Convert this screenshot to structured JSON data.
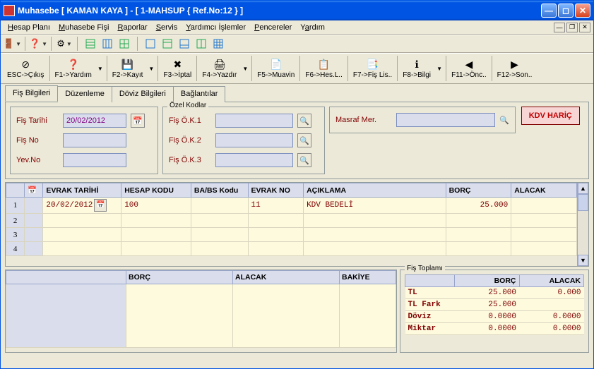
{
  "window": {
    "title": "Muhasebe [ KAMAN KAYA ]  - [ 1-MAHSUP { Ref.No:12 } ]"
  },
  "menu": {
    "hesap_plani": "Hesap Planı",
    "muhasebe_fisi": "Muhasebe Fişi",
    "raporlar": "Raporlar",
    "servis": "Servis",
    "yardimci": "Yardımcı İşlemler",
    "pencereler": "Pencereler",
    "yardim": "Yardım"
  },
  "toolbar": {
    "esc": "ESC->Çıkış",
    "f1": "F1->Yardım",
    "f2": "F2->Kayıt",
    "f3": "F3->İptal",
    "f4": "F4->Yazdır",
    "f5": "F5->Muavin",
    "f6": "F6->Hes.L..",
    "f7": "F7->Fiş Lis..",
    "f8": "F8->Bilgi",
    "f11": "F11->Önc..",
    "f12": "F12->Son.."
  },
  "tabs": {
    "fis_bilgileri": "Fiş Bilgileri",
    "duzenleme": "Düzenleme",
    "doviz": "Döviz Bilgileri",
    "baglantilar": "Bağlantılar"
  },
  "form": {
    "fis_tarihi_label": "Fiş Tarihi",
    "fis_tarihi_value": "20/02/2012",
    "fis_no_label": "Fiş No",
    "fis_no_value": "",
    "yev_no_label": "Yev.No",
    "yev_no_value": "",
    "ozel_kodlar": "Özel Kodlar",
    "ok1_label": "Fiş Ö.K.1",
    "ok1_value": "",
    "ok2_label": "Fiş Ö.K.2",
    "ok2_value": "",
    "ok3_label": "Fiş Ö.K.3",
    "ok3_value": "",
    "masraf_label": "Masraf Mer.",
    "masraf_value": "",
    "kdv_haric": "KDV HARİÇ"
  },
  "grid": {
    "headers": {
      "evrak_tarihi": "EVRAK TARİHİ",
      "hesap_kodu": "HESAP KODU",
      "babs": "BA/BS Kodu",
      "evrak_no": "EVRAK NO",
      "aciklama": "AÇIKLAMA",
      "borc": "BORÇ",
      "alacak": "ALACAK"
    },
    "rows": [
      {
        "num": "1",
        "evrak_tarihi": "20/02/2012",
        "hesap_kodu": "100",
        "babs": "",
        "evrak_no": "11",
        "aciklama": "KDV BEDELİ",
        "borc": "25.000",
        "alacak": ""
      },
      {
        "num": "2",
        "evrak_tarihi": "",
        "hesap_kodu": "",
        "babs": "",
        "evrak_no": "",
        "aciklama": "",
        "borc": "",
        "alacak": ""
      },
      {
        "num": "3",
        "evrak_tarihi": "",
        "hesap_kodu": "",
        "babs": "",
        "evrak_no": "",
        "aciklama": "",
        "borc": "",
        "alacak": ""
      },
      {
        "num": "4",
        "evrak_tarihi": "",
        "hesap_kodu": "",
        "babs": "",
        "evrak_no": "",
        "aciklama": "",
        "borc": "",
        "alacak": ""
      }
    ]
  },
  "bottom_left": {
    "borc": "BORÇ",
    "alacak": "ALACAK",
    "bakiye": "BAKİYE"
  },
  "totals": {
    "legend": "Fiş Toplamı",
    "header_borc": "BORÇ",
    "header_alacak": "ALACAK",
    "rows": [
      {
        "label": "TL",
        "borc": "25.000",
        "alacak": "0.000"
      },
      {
        "label": "TL Fark",
        "borc": "25.000",
        "alacak": ""
      },
      {
        "label": "Döviz",
        "borc": "0.0000",
        "alacak": "0.0000"
      },
      {
        "label": "Miktar",
        "borc": "0.0000",
        "alacak": "0.0000"
      }
    ]
  }
}
